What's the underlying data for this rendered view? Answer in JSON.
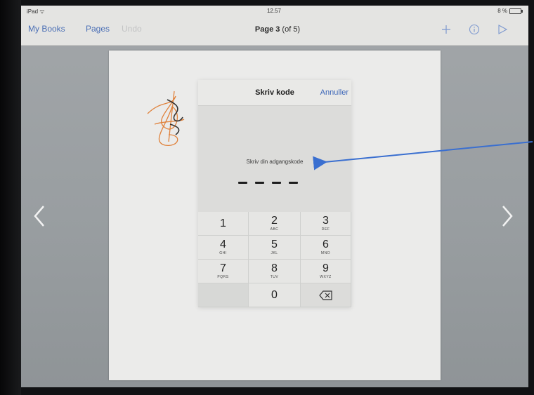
{
  "status_bar": {
    "device": "iPad",
    "time": "12.57",
    "battery": "8 %"
  },
  "nav": {
    "my_books": "My Books",
    "pages": "Pages",
    "undo": "Undo",
    "title_bold": "Page 3",
    "title_rest": " (of 5)",
    "icons": [
      "plus-icon",
      "info-icon",
      "play-icon"
    ]
  },
  "dialog": {
    "title": "Skriv kode",
    "cancel": "Annuller",
    "prompt": "Skriv din adgangskode",
    "passcode_length": 4
  },
  "keypad": {
    "keys": [
      {
        "num": "1",
        "letters": ""
      },
      {
        "num": "2",
        "letters": "ABC"
      },
      {
        "num": "3",
        "letters": "DEF"
      },
      {
        "num": "4",
        "letters": "GHI"
      },
      {
        "num": "5",
        "letters": "JKL"
      },
      {
        "num": "6",
        "letters": "MNO"
      },
      {
        "num": "7",
        "letters": "PQRS"
      },
      {
        "num": "8",
        "letters": "TUV"
      },
      {
        "num": "9",
        "letters": "WXYZ"
      },
      {
        "num": "",
        "letters": ""
      },
      {
        "num": "0",
        "letters": ""
      },
      {
        "num": "",
        "letters": "",
        "icon": "delete-icon"
      }
    ]
  },
  "colors": {
    "accent": "#4b6fb5",
    "annotation_arrow": "#3a6fd0",
    "scribble": "#e0823c"
  }
}
